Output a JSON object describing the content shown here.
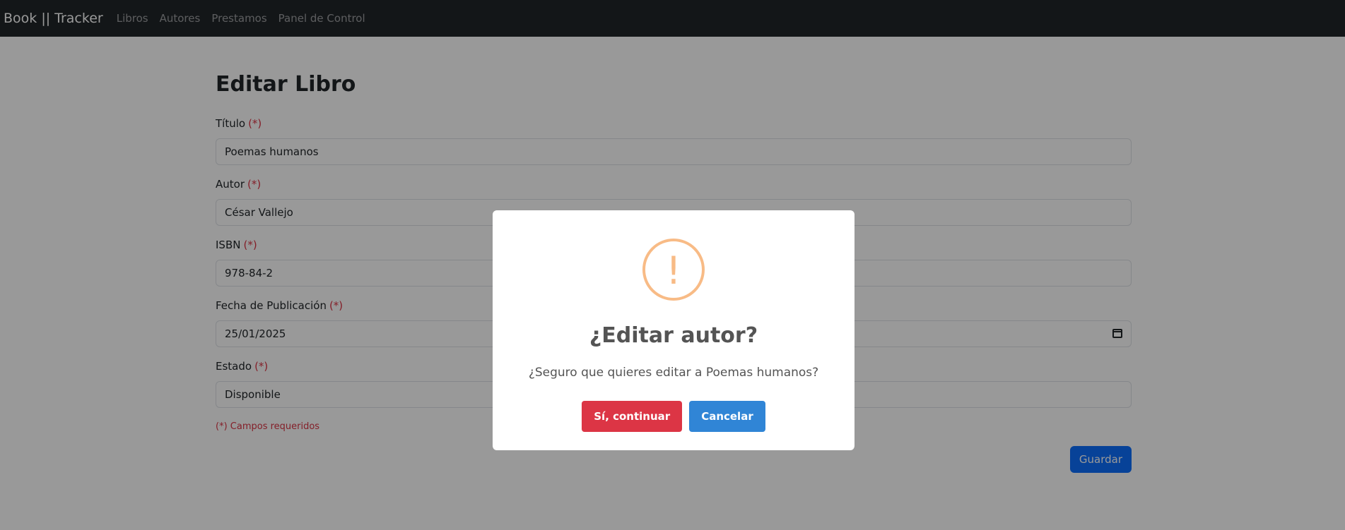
{
  "navbar": {
    "brand": "Book || Tracker",
    "links": [
      "Libros",
      "Autores",
      "Prestamos",
      "Panel de Control"
    ]
  },
  "form": {
    "title": "Editar Libro",
    "required_marker": "(*)",
    "fields": [
      {
        "label": "Título",
        "value": "Poemas humanos"
      },
      {
        "label": "Autor",
        "value": "César Vallejo"
      },
      {
        "label": "ISBN",
        "value": "978-84-2"
      },
      {
        "label": "Fecha de Publicación",
        "value": "25/01/2025"
      },
      {
        "label": "Estado",
        "value": "Disponible"
      }
    ],
    "required_note": "(*) Campos requeridos",
    "save_label": "Guardar"
  },
  "dialog": {
    "icon": "warning-icon",
    "icon_glyph": "!",
    "title": "¿Editar autor?",
    "text": "¿Seguro que quieres editar a Poemas humanos?",
    "confirm_label": "Sí, continuar",
    "cancel_label": "Cancelar",
    "colors": {
      "warning": "#f8bb86",
      "confirm": "#dc3545",
      "cancel": "#3085d6"
    }
  }
}
